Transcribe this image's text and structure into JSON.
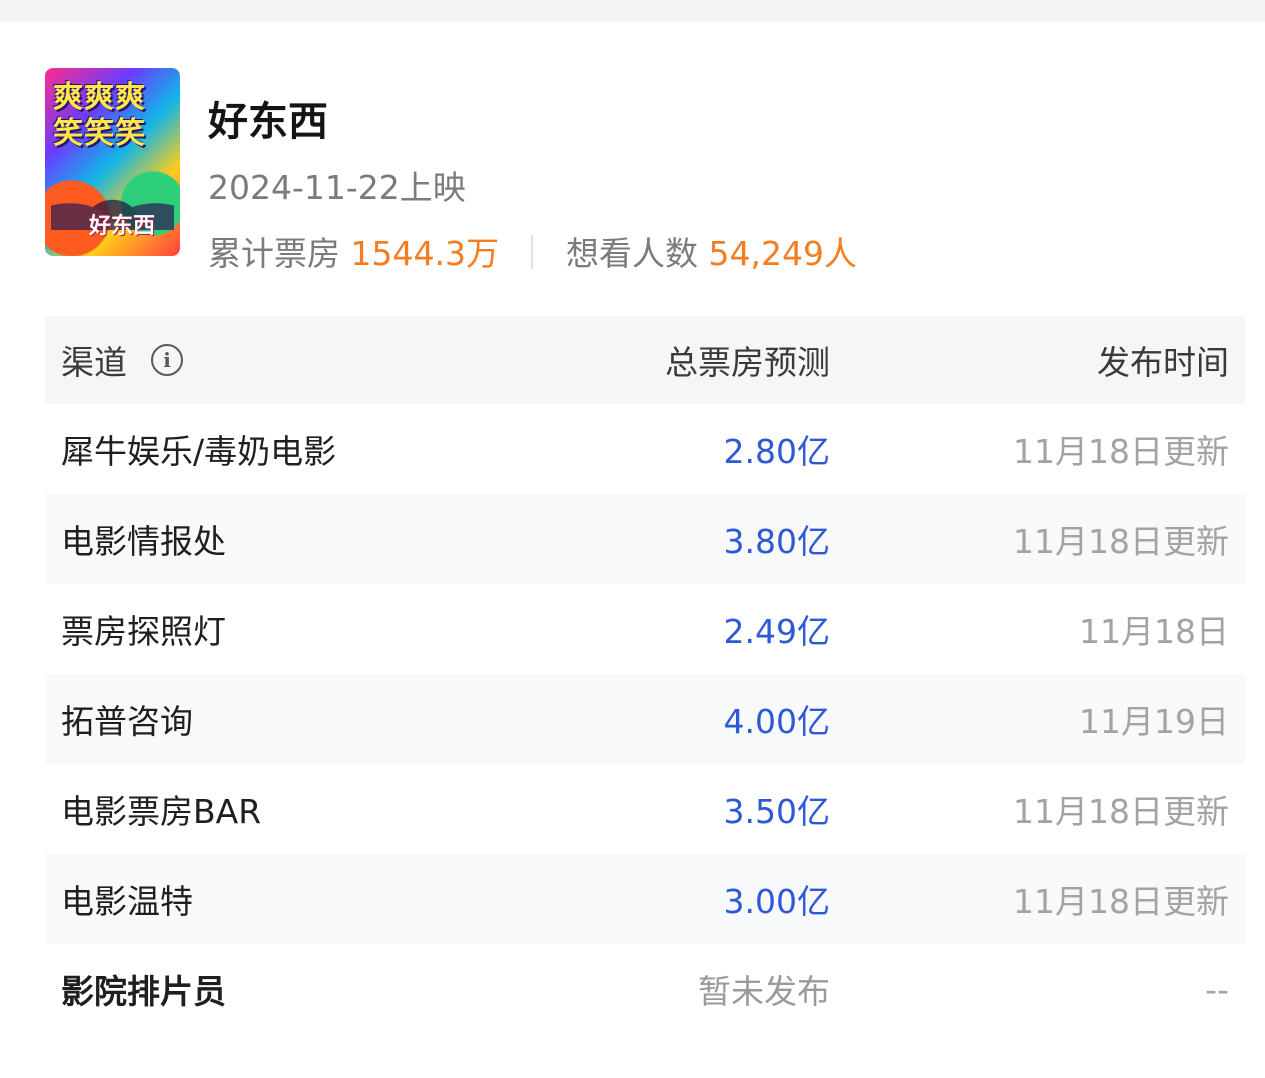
{
  "movie": {
    "poster": {
      "lines": [
        "爽爽爽",
        "笑笑笑"
      ],
      "title": "好东西"
    },
    "title": "好东西",
    "release": "2024-11-22上映",
    "box_office_label": "累计票房",
    "box_office_value": "1544.3万",
    "want_label": "想看人数",
    "want_value": "54,249人"
  },
  "table": {
    "headers": {
      "channel": "渠道",
      "prediction": "总票房预测",
      "time": "发布时间"
    },
    "info_icon": "info-icon",
    "rows": [
      {
        "channel": "犀牛娱乐/毒奶电影",
        "prediction": "2.80亿",
        "time": "11月18日更新"
      },
      {
        "channel": "电影情报处",
        "prediction": "3.80亿",
        "time": "11月18日更新"
      },
      {
        "channel": "票房探照灯",
        "prediction": "2.49亿",
        "time": "11月18日"
      },
      {
        "channel": "拓普咨询",
        "prediction": "4.00亿",
        "time": "11月19日"
      },
      {
        "channel": "电影票房BAR",
        "prediction": "3.50亿",
        "time": "11月18日更新"
      },
      {
        "channel": "电影温特",
        "prediction": "3.00亿",
        "time": "11月18日更新"
      },
      {
        "channel": "影院排片员",
        "prediction": "暂未发布",
        "time": "--"
      }
    ]
  },
  "colors": {
    "accent_orange": "#f57d20",
    "prediction_blue": "#2d59d6",
    "muted_gray": "#a3a3a3",
    "header_bg": "#f5f6f8",
    "stripe_bg": "#f8f9fb"
  }
}
